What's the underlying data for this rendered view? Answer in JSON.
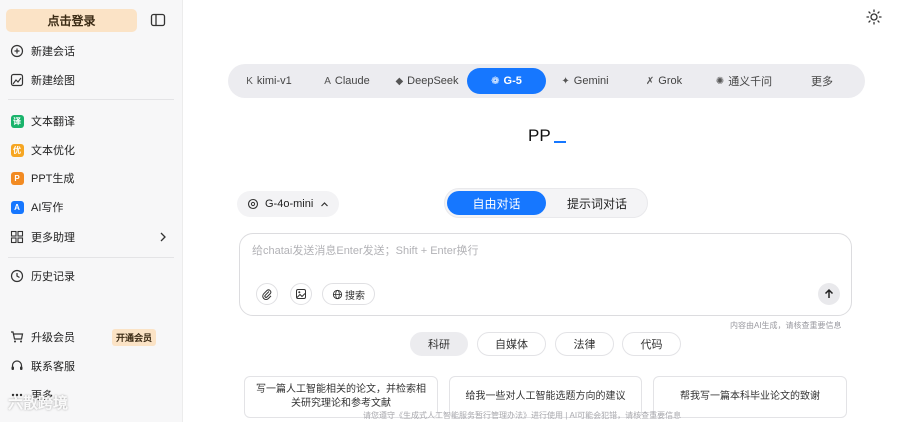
{
  "sidebar": {
    "login_label": "点击登录",
    "items": [
      {
        "label": "新建会话",
        "icon": "chat-plus-icon"
      },
      {
        "label": "新建绘图",
        "icon": "image-plus-icon"
      },
      {
        "label": "文本翻译",
        "icon": "translate-icon",
        "color": "#19b36b"
      },
      {
        "label": "文本优化",
        "icon": "optimize-icon",
        "color": "#f6a623"
      },
      {
        "label": "PPT生成",
        "icon": "ppt-icon",
        "color": "#f28b23"
      },
      {
        "label": "AI写作",
        "icon": "ai-write-icon",
        "color": "#1677ff"
      },
      {
        "label": "更多助理",
        "icon": "grid-icon"
      },
      {
        "label": "历史记录",
        "icon": "history-icon"
      },
      {
        "label": "升级会员",
        "icon": "cart-icon",
        "badge": "开通会员"
      },
      {
        "label": "联系客服",
        "icon": "headset-icon"
      },
      {
        "label": "更多",
        "icon": "more-icon"
      }
    ]
  },
  "models": {
    "tabs": [
      "kimi-v1",
      "Claude",
      "DeepSeek",
      "G-5",
      "Gemini",
      "Grok",
      "通义千问",
      "更多"
    ],
    "active": "G-5"
  },
  "hero": {
    "text": "PP"
  },
  "model_select": {
    "label": "G-4o-mini"
  },
  "mode": {
    "active": "自由对话",
    "inactive": "提示词对话"
  },
  "input": {
    "placeholder": "给chatai发送消息Enter发送；Shift + Enter换行",
    "search_label": "搜索"
  },
  "ai_note": "内容由AI生成，请核查重要信息",
  "categories": [
    "科研",
    "自媒体",
    "法律",
    "代码"
  ],
  "active_category": "科研",
  "suggestions": [
    "写一篇人工智能相关的论文，并检索相关研究理论和参考文献",
    "给我一些对人工智能选题方向的建议",
    "帮我写一篇本科毕业论文的致谢"
  ],
  "footer": "请您遵守《生成式人工智能服务暂行管理办法》进行使用 | AI可能会犯错，请核查重要信息",
  "watermark": "六散跨境",
  "colors": {
    "accent": "#1677ff",
    "login_bg": "#fbe3c6"
  }
}
